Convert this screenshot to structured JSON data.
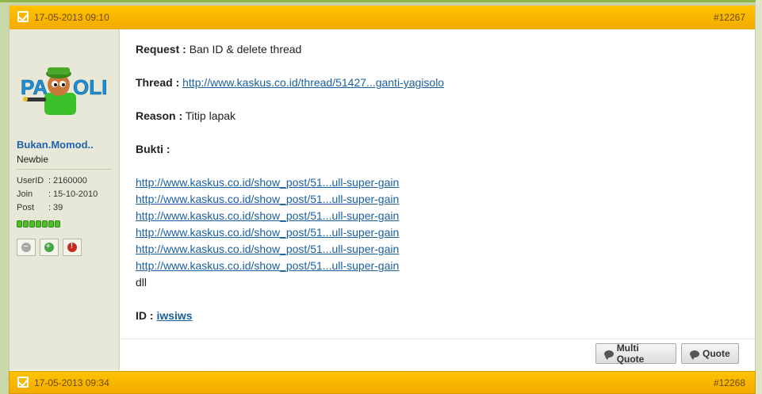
{
  "post": {
    "date": "17-05-2013 09:10",
    "number": "#12267",
    "author": {
      "username": "Bukan.Momod..",
      "rank": "Newbie",
      "logo_text": "PA OLI",
      "info": [
        {
          "key": "UserID",
          "value": "2160000"
        },
        {
          "key": "Join",
          "value": "15-10-2010"
        },
        {
          "key": "Post",
          "value": "39"
        }
      ]
    },
    "body": {
      "request_label": "Request :",
      "request_value": "Ban ID & delete thread",
      "thread_label": "Thread :",
      "thread_link": "http://www.kaskus.co.id/thread/51427...ganti-yagisolo",
      "reason_label": "Reason :",
      "reason_value": "Titip lapak",
      "bukti_label": "Bukti :",
      "bukti_links": [
        "http://www.kaskus.co.id/show_post/51...ull-super-gain",
        "http://www.kaskus.co.id/show_post/51...ull-super-gain",
        "http://www.kaskus.co.id/show_post/51...ull-super-gain",
        "http://www.kaskus.co.id/show_post/51...ull-super-gain",
        "http://www.kaskus.co.id/show_post/51...ull-super-gain",
        "http://www.kaskus.co.id/show_post/51...ull-super-gain"
      ],
      "dll": "dll",
      "id_label": "ID :",
      "id_value": "iwsiws"
    },
    "buttons": {
      "multi_quote": "Multi Quote",
      "quote": "Quote"
    }
  },
  "next_post": {
    "date": "17-05-2013 09:34",
    "number": "#12268"
  },
  "colors": {
    "header": "#f3aa00",
    "link": "#1a5f9e",
    "username": "#1f63b0"
  }
}
